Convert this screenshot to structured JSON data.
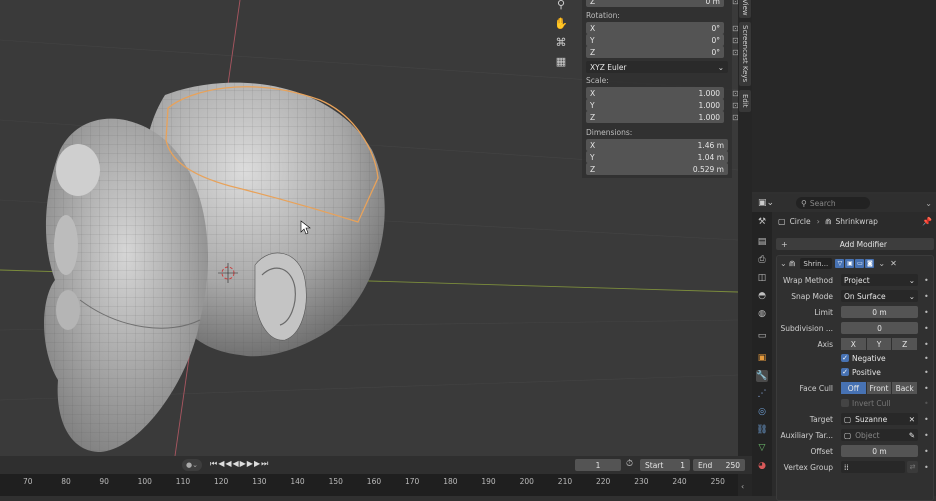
{
  "npanel": {
    "z_top": {
      "label": "Z",
      "value": "0 m"
    },
    "rotation_label": "Rotation:",
    "rotation": [
      {
        "label": "X",
        "value": "0°"
      },
      {
        "label": "Y",
        "value": "0°"
      },
      {
        "label": "Z",
        "value": "0°"
      }
    ],
    "rotation_mode": "XYZ Euler",
    "scale_label": "Scale:",
    "scale": [
      {
        "label": "X",
        "value": "1.000"
      },
      {
        "label": "Y",
        "value": "1.000"
      },
      {
        "label": "Z",
        "value": "1.000"
      }
    ],
    "dimensions_label": "Dimensions:",
    "dimensions": [
      {
        "label": "X",
        "value": "1.46 m"
      },
      {
        "label": "Y",
        "value": "1.04 m"
      },
      {
        "label": "Z",
        "value": "0.529 m"
      }
    ]
  },
  "side_tabs": [
    "View",
    "Screencast Keys",
    "Edit"
  ],
  "properties": {
    "search_placeholder": "Search",
    "breadcrumb_object": "Circle",
    "breadcrumb_modifier": "Shrinkwrap",
    "add_modifier": "Add Modifier",
    "modifier_name": "Shrin...",
    "wrap_method": {
      "label": "Wrap Method",
      "value": "Project"
    },
    "snap_mode": {
      "label": "Snap Mode",
      "value": "On Surface"
    },
    "limit": {
      "label": "Limit",
      "value": "0 m"
    },
    "subdivision": {
      "label": "Subdivision ...",
      "value": "0"
    },
    "axis": {
      "label": "Axis",
      "options": [
        "X",
        "Y",
        "Z"
      ]
    },
    "negative": "Negative",
    "positive": "Positive",
    "face_cull": {
      "label": "Face Cull",
      "options": [
        "Off",
        "Front",
        "Back"
      ],
      "selected": "Off"
    },
    "invert_cull": "Invert Cull",
    "target": {
      "label": "Target",
      "value": "Suzanne"
    },
    "auxiliary_target": {
      "label": "Auxiliary Tar...",
      "placeholder": "Object"
    },
    "offset": {
      "label": "Offset",
      "value": "0 m"
    },
    "vertex_group": {
      "label": "Vertex Group",
      "value": ""
    }
  },
  "timeline": {
    "current_frame": "1",
    "start_label": "Start",
    "start_value": "1",
    "end_label": "End",
    "end_value": "250",
    "ticks": [
      "70",
      "80",
      "90",
      "100",
      "110",
      "120",
      "130",
      "140",
      "150",
      "160",
      "170",
      "180",
      "190",
      "200",
      "210",
      "220",
      "230",
      "240",
      "250"
    ]
  },
  "colors": {
    "accent": "#4772b3",
    "selection": "#e8a25a",
    "x_axis": "#b55b62",
    "y_axis": "#8da83f"
  }
}
